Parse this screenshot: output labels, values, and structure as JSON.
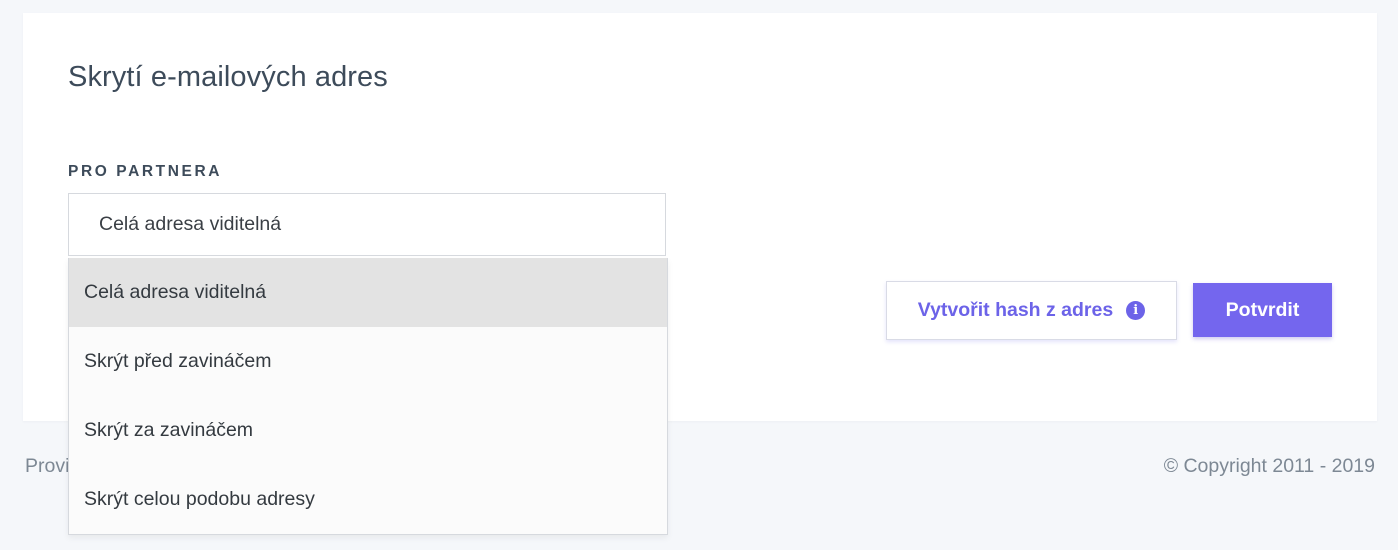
{
  "page": {
    "title": "Skrytí e-mailových adres",
    "field_label": "PRO PARTNERA",
    "select_value": "Celá adresa viditelná",
    "dropdown_options": [
      "Celá adresa viditelná",
      "Skrýt před zavináčem",
      "Skrýt za zavináčem",
      "Skrýt celou podobu adresy"
    ],
    "selected_option_index": 0,
    "buttons": {
      "hash_label": "Vytvořit hash z adres",
      "confirm_label": "Potvrdit"
    },
    "info_icon": "info-icon",
    "colors": {
      "accent": "#7466ee",
      "selected_option_bg": "#e3e3e3"
    }
  },
  "footer": {
    "left_text": "Provi",
    "copyright": "© Copyright 2011 - 2019"
  }
}
